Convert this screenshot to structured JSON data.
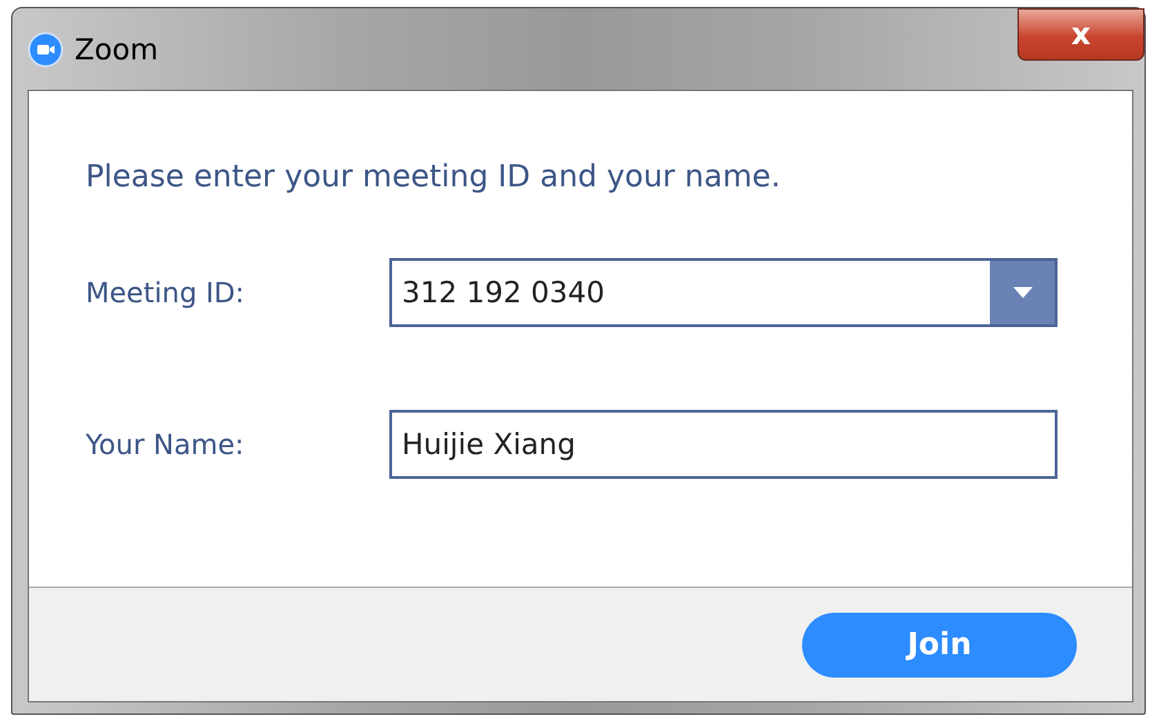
{
  "window": {
    "title": "Zoom",
    "close": "x"
  },
  "instruction": "Please enter your meeting ID and your name.",
  "fields": [
    {
      "kind": "dropdown",
      "label": "Meeting ID:",
      "value": "312 192 0340"
    },
    {
      "kind": "text",
      "label": "Your Name:",
      "value": "Huijie Xiang"
    }
  ],
  "button": "Join"
}
